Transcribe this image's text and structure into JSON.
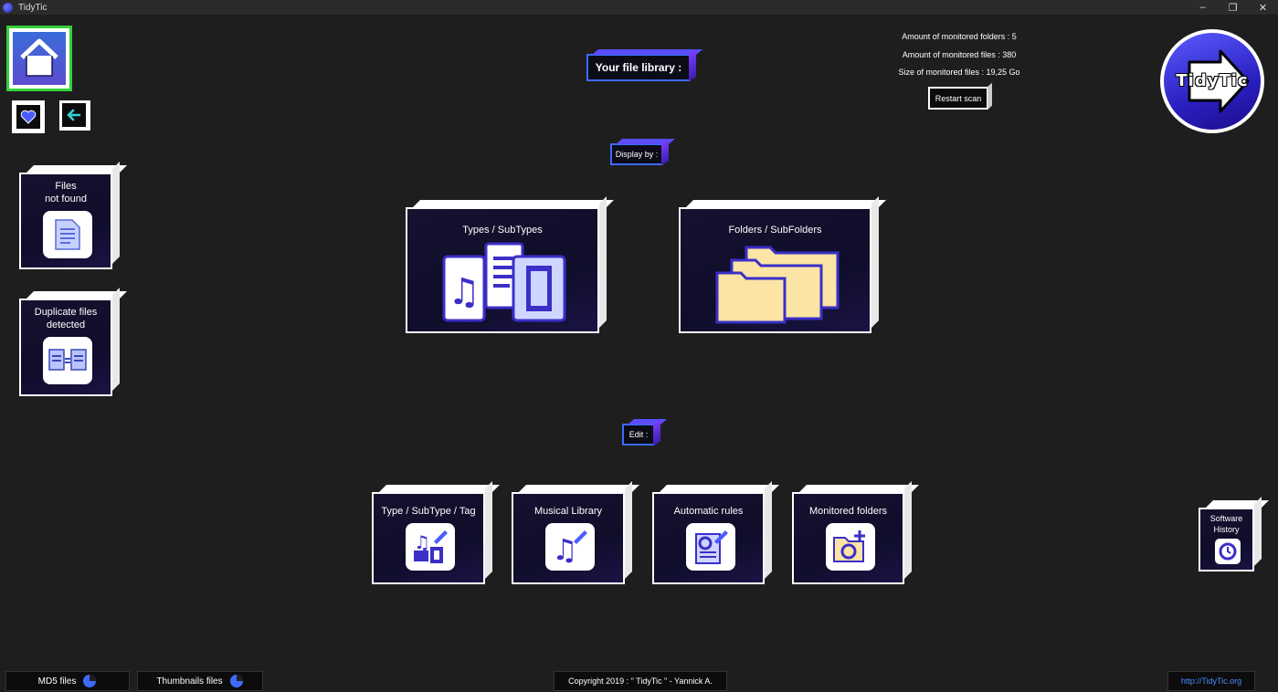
{
  "window": {
    "title": "TidyTic",
    "minimize_label": "–",
    "restore_label": "❐",
    "close_label": "✕"
  },
  "header": {
    "library_label": "Your file library :"
  },
  "stats": {
    "folders": "Amount of monitored folders : 5",
    "files": "Amount of monitored files : 380",
    "size": "Size of monitored files : 19,25 Go",
    "restart_label": "Restart scan"
  },
  "logo": {
    "text": "TidyTic"
  },
  "sidebar": {
    "files_not_found": "Files\nnot found",
    "duplicates": "Duplicate files\ndetected"
  },
  "display": {
    "label": "Display by :",
    "types": "Types / SubTypes",
    "folders": "Folders / SubFolders"
  },
  "edit": {
    "label": "Edit :",
    "items": [
      {
        "label": "Type / SubType / Tag"
      },
      {
        "label": "Musical Library"
      },
      {
        "label": "Automatic rules"
      },
      {
        "label": "Monitored folders"
      }
    ]
  },
  "history": {
    "label": "Software\nHistory"
  },
  "footer": {
    "md5": "MD5 files",
    "thumbs": "Thumbnails files",
    "copyright": "Copyright 2019 : \" TidyTic \" - Yannick A.",
    "link": "http://TidyTic.org"
  },
  "colors": {
    "accent": "#3d6bff",
    "purple": "#7a3cff",
    "folder": "#fbe4a4",
    "home_border": "#35d13a"
  },
  "icons": [
    "home-icon",
    "heart-icon",
    "back-arrow-icon",
    "document-icon",
    "duplicate-icon",
    "media-files-icon",
    "folders-icon",
    "tag-edit-icon",
    "music-edit-icon",
    "rules-edit-icon",
    "folder-add-icon",
    "history-icon",
    "pie-icon"
  ]
}
